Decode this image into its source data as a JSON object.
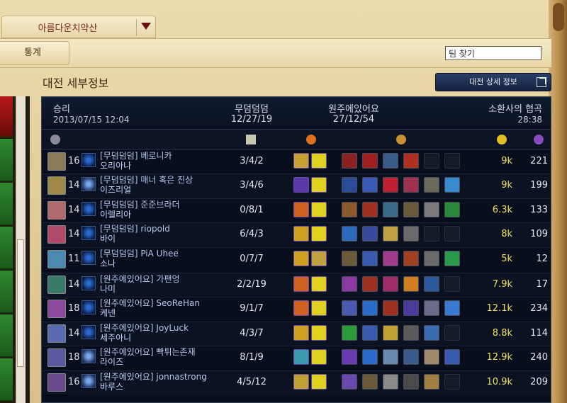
{
  "summoner_tab": {
    "name": "아름다운치약산"
  },
  "toolbar": {
    "stats_label": "통계",
    "team_search_value": "팀 찾기"
  },
  "section_title": "대전 세부정보",
  "detail_button_label": "대전 상세 정보",
  "match": {
    "result": "승리",
    "datetime": "2013/07/15 12:04",
    "team1_name": "무덤덤덤",
    "team1_score": "12/27/19",
    "team2_name": "원주에있어요",
    "team2_score": "27/12/54",
    "mode": "소환사의 협곡",
    "duration": "28:38"
  },
  "colors": {
    "gold_text": "#f0e060",
    "name_text": "#b8c6f0",
    "panel_bg": "#080e1c",
    "result_win": "#d8dce8"
  },
  "players": [
    {
      "level": "16",
      "player": "[무덤덤덤] 베로니카",
      "champion": "오리아나",
      "kda": "3/4/2",
      "gold": "9k",
      "cs": "221",
      "champ_color": "#8a7a5a",
      "summ_b": false,
      "spells": [
        "#c8a030",
        "#e0d020"
      ],
      "items": [
        "#8a2020",
        "#a02020",
        "#3a5a8a",
        "#b03020",
        "empty",
        "empty"
      ]
    },
    {
      "level": "14",
      "player": "[무덤덤덤] 매너 혹은 진상",
      "champion": "이즈리얼",
      "kda": "3/4/6",
      "gold": "9k",
      "cs": "199",
      "champ_color": "#a08a4a",
      "summ_b": true,
      "spells": [
        "#5a3aa8",
        "#e0d020"
      ],
      "items": [
        "#2a4a9a",
        "#3a5ab8",
        "#c02030",
        "#a03050",
        "#6a6a5a",
        "#3a8ad0"
      ]
    },
    {
      "level": "14",
      "player": "[무덤덤덤] 준준브라더",
      "champion": "이렐리아",
      "kda": "0/8/1",
      "gold": "6.3k",
      "cs": "133",
      "champ_color": "#b06a6a",
      "summ_b": false,
      "spells": [
        "#d06020",
        "#e0d020"
      ],
      "items": [
        "#8a5a2a",
        "#a03020",
        "#3a6a8a",
        "#6a5a3a",
        "#7a7a7a",
        "#2a8a3a"
      ]
    },
    {
      "level": "14",
      "player": "[무덤덤덤] riopold",
      "champion": "바이",
      "kda": "6/4/3",
      "gold": "8k",
      "cs": "109",
      "champ_color": "#b04a6a",
      "summ_b": false,
      "spells": [
        "#d0a020",
        "#e0d020"
      ],
      "items": [
        "#2a6ab8",
        "#3a4a9a",
        "#c0a040",
        "#6a6a6a",
        "empty",
        "empty"
      ]
    },
    {
      "level": "11",
      "player": "[무덤덤덤] PiA Uhee",
      "champion": "소나",
      "kda": "0/7/7",
      "gold": "5k",
      "cs": "12",
      "champ_color": "#4a8ab0",
      "summ_b": false,
      "spells": [
        "#d0a020",
        "#c0a040"
      ],
      "items": [
        "#6a5a3a",
        "#3a5ab0",
        "#a03a8a",
        "#a04020",
        "#6a6a6a",
        "#2a9a4a"
      ]
    },
    {
      "level": "14",
      "player": "[원주에있어요] 가팬엉",
      "champion": "나미",
      "kda": "2/2/19",
      "gold": "7.9k",
      "cs": "17",
      "champ_color": "#3a7a6a",
      "summ_b": false,
      "spells": [
        "#d06020",
        "#e0d020"
      ],
      "items": [
        "#8a3aa0",
        "#a03020",
        "#a02a6a",
        "#d08020",
        "#2a5a9a",
        "empty"
      ]
    },
    {
      "level": "18",
      "player": "[원주에있어요] SeoReHan",
      "champion": "케넨",
      "kda": "9/1/7",
      "gold": "12.1k",
      "cs": "234",
      "champ_color": "#8a4aa0",
      "summ_b": false,
      "spells": [
        "#d06020",
        "#e0d020"
      ],
      "items": [
        "#4a5ab0",
        "#2a6ac8",
        "#a03020",
        "#4a3a9a",
        "#6a6a8a",
        "#3a7ad0"
      ]
    },
    {
      "level": "14",
      "player": "[원주에있어요] JoyLuck",
      "champion": "세주아니",
      "kda": "4/3/7",
      "gold": "8.8k",
      "cs": "114",
      "champ_color": "#5a6ab0",
      "summ_b": false,
      "spells": [
        "#d0a020",
        "#e0d020"
      ],
      "items": [
        "#2a9a3a",
        "#3a5ab0",
        "#c0a030",
        "#5a5a5a",
        "#3a6ab0",
        "empty"
      ]
    },
    {
      "level": "18",
      "player": "[원주에있어요] 빡튀는존재",
      "champion": "라이즈",
      "kda": "8/1/9",
      "gold": "12.9k",
      "cs": "240",
      "champ_color": "#5a5aa0",
      "summ_b": true,
      "spells": [
        "#3a9ab0",
        "#e0d020"
      ],
      "items": [
        "#6a3ab0",
        "#2a6ac8",
        "#6a8ab0",
        "#3a5a8a",
        "#a08a6a",
        "#3a5ab0"
      ]
    },
    {
      "level": "16",
      "player": "[원주에있어요] jonnastrong",
      "champion": "바루스",
      "kda": "4/5/12",
      "gold": "10.9k",
      "cs": "209",
      "champ_color": "#6a4a8a",
      "summ_b": true,
      "spells": [
        "#c0a030",
        "#e0d020"
      ],
      "items": [
        "#6a4ab0",
        "#6a5a3a",
        "#8a8a8a",
        "#4a4a4a",
        "#a08040",
        "empty"
      ]
    }
  ],
  "column_icons": [
    "summoner-icon",
    "crossed-swords-icon",
    "spell-flame-icon",
    "gold-bag-icon",
    "gold-coins-icon",
    "minion-icon"
  ]
}
